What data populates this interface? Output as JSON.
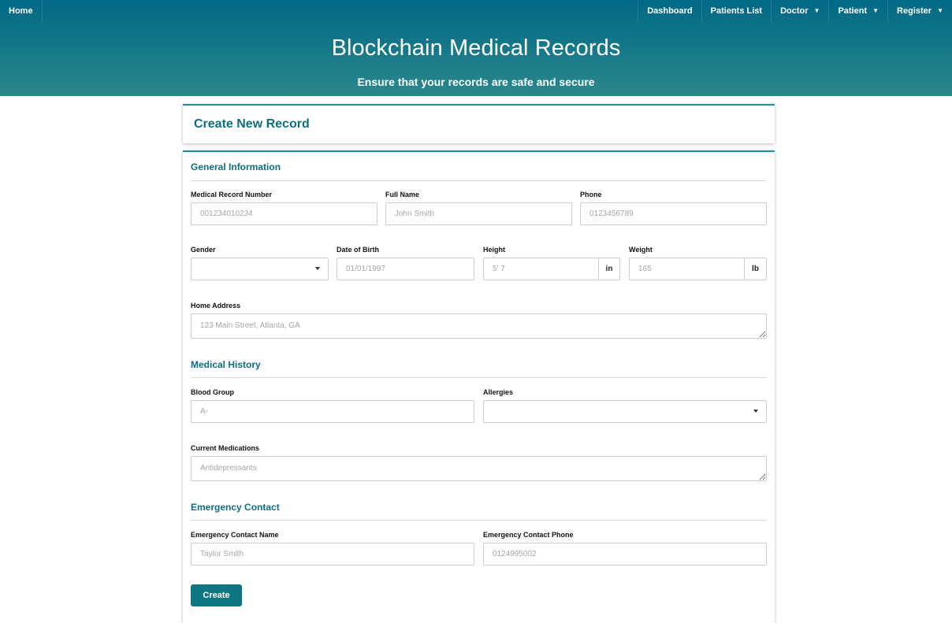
{
  "nav": {
    "home": "Home",
    "dashboard": "Dashboard",
    "patients_list": "Patients List",
    "doctor": "Doctor",
    "patient": "Patient",
    "register": "Register"
  },
  "hero": {
    "title": "Blockchain Medical Records",
    "subtitle": "Ensure that your records are safe and secure"
  },
  "page": {
    "heading": "Create New Record"
  },
  "general": {
    "title": "General Information",
    "mrn_label": "Medical Record Number",
    "mrn_placeholder": "001234010234",
    "name_label": "Full Name",
    "name_placeholder": "John Smith",
    "phone_label": "Phone",
    "phone_placeholder": "0123456789",
    "gender_label": "Gender",
    "gender_value": "",
    "dob_label": "Date of Birth",
    "dob_placeholder": "01/01/1997",
    "height_label": "Height",
    "height_placeholder": "5' 7",
    "height_unit": "in",
    "weight_label": "Weight",
    "weight_placeholder": "165",
    "weight_unit": "lb",
    "address_label": "Home Address",
    "address_placeholder": "123 Main Street, Atlanta, GA"
  },
  "history": {
    "title": "Medical History",
    "blood_label": "Blood Group",
    "blood_placeholder": "A-",
    "allergies_label": "Allergies",
    "allergies_value": "",
    "meds_label": "Current Medications",
    "meds_placeholder": "Antidepressants"
  },
  "emergency": {
    "title": "Emergency Contact",
    "name_label": "Emergency Contact Name",
    "name_placeholder": "Taylor Smith",
    "phone_label": "Emergency Contact Phone",
    "phone_placeholder": "0124995002"
  },
  "actions": {
    "create": "Create"
  },
  "colors": {
    "accent": "#0e7582",
    "header_top": "#006985",
    "header_bottom": "#2a878a"
  }
}
